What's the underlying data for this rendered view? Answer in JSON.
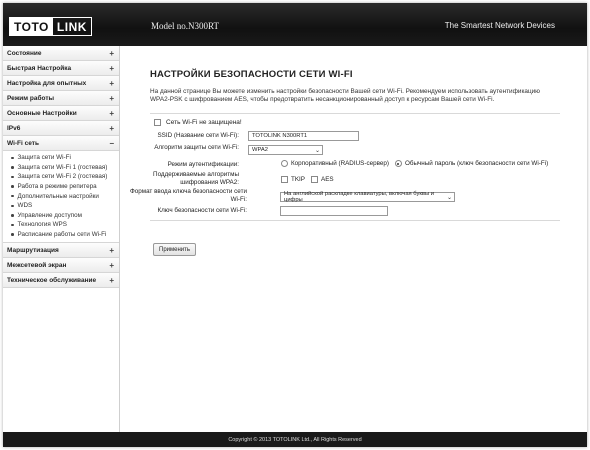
{
  "header": {
    "logo_left": "TOTO",
    "logo_right": "LINK",
    "model": "Model no.N300RT",
    "tagline": "The Smartest Network Devices"
  },
  "sidebar": {
    "items_top": [
      {
        "label": "Состояние",
        "sign": "+"
      },
      {
        "label": "Быстрая Настройка",
        "sign": "+"
      },
      {
        "label": "Настройка для опытных",
        "sign": "+"
      },
      {
        "label": "Режим работы",
        "sign": "+"
      },
      {
        "label": "Основные Настройки",
        "sign": "+"
      },
      {
        "label": "IPv6",
        "sign": "+"
      },
      {
        "label": "Wi-Fi сеть",
        "sign": "−"
      }
    ],
    "wifi_sub": [
      "Защита сети Wi-Fi",
      "Защита сети Wi-Fi 1 (гостевая)",
      "Защита сети Wi-Fi 2 (гостевая)",
      "Работа в режиме репитера",
      "Дополнительные настройки",
      "WDS",
      "Управление доступом",
      "Технология WPS",
      "Расписание работы сети Wi-Fi"
    ],
    "items_bottom": [
      {
        "label": "Маршрутизация",
        "sign": "+"
      },
      {
        "label": "Межсетевой экран",
        "sign": "+"
      },
      {
        "label": "Техническое обслуживание",
        "sign": "+"
      }
    ]
  },
  "main": {
    "title": "НАСТРОЙКИ БЕЗОПАСНОСТИ СЕТИ WI-FI",
    "description": "На данной странице Вы можете изменить настройки безопасности Вашей сети Wi-Fi. Рекомендуем использовать аутентификацию WPA2-PSK с шифрованием AES, чтобы предотвратить несанкционированный доступ к ресурсам Вашей сети Wi-Fi.",
    "unprotected_label": "Сеть Wi-Fi не защищена!",
    "ssid_label": "SSID (Название сети Wi-Fi):",
    "ssid_value": "TOTOLINK N300RT1",
    "algorithm_label": "Алгоритм защиты сети Wi-Fi:",
    "algorithm_value": "WPA2",
    "auth_label": "Режим аутентификации:",
    "auth_options": [
      "Корпоративный (RADIUS-сервер)",
      "Обычный пароль (ключ безопасности сети Wi-Fi)"
    ],
    "auth_selected": 1,
    "ciphers_label": "Поддерживаемые алгоритмы шифрования WPA2:",
    "cipher_tkip": "TKIP",
    "cipher_aes": "AES",
    "keyformat_label": "Формат ввода ключа безопасности сети Wi-Fi:",
    "keyformat_value": "На английской раскладке клавиатуры, включая буквы и цифры",
    "key_label": "Ключ безопасности сети Wi-Fi:",
    "key_value": "",
    "apply_button": "Применить"
  },
  "footer": {
    "copyright": "Copyright © 2013 TOTOLINK Ltd.,  All Rights Reserved"
  }
}
